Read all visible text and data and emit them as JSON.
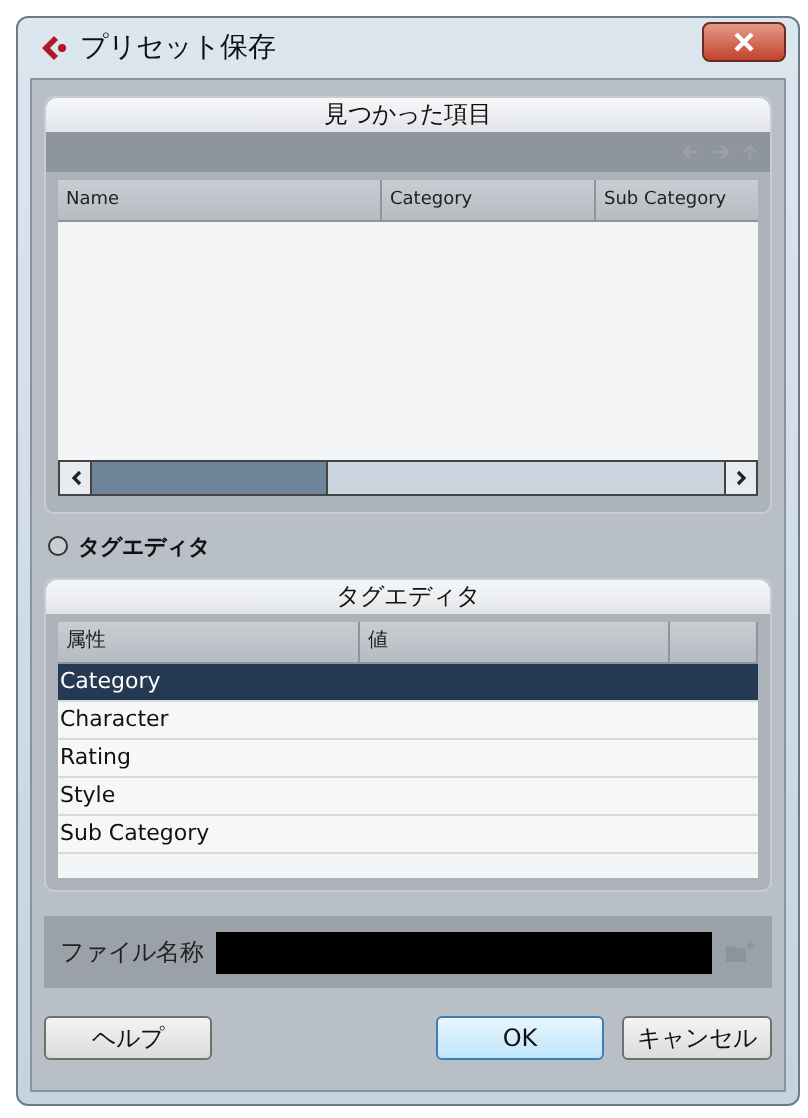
{
  "window": {
    "title": "プリセット保存"
  },
  "found_panel": {
    "title": "見つかった項目",
    "columns": [
      "Name",
      "Category",
      "Sub Category"
    ]
  },
  "tag_option": {
    "label": "タグエディタ",
    "selected": false
  },
  "tag_panel": {
    "title": "タグエディタ",
    "columns": [
      "属性",
      "値"
    ],
    "rows": [
      {
        "attribute": "Category",
        "selected": true
      },
      {
        "attribute": "Character",
        "selected": false
      },
      {
        "attribute": "Rating",
        "selected": false
      },
      {
        "attribute": "Style",
        "selected": false
      },
      {
        "attribute": "Sub Category",
        "selected": false
      }
    ]
  },
  "file_name": {
    "label": "ファイル名称"
  },
  "buttons": [
    {
      "label": "ヘルプ",
      "kind": "left"
    },
    {
      "label": "OK",
      "kind": "default"
    },
    {
      "label": "キャンセル",
      "kind": "normal"
    }
  ]
}
